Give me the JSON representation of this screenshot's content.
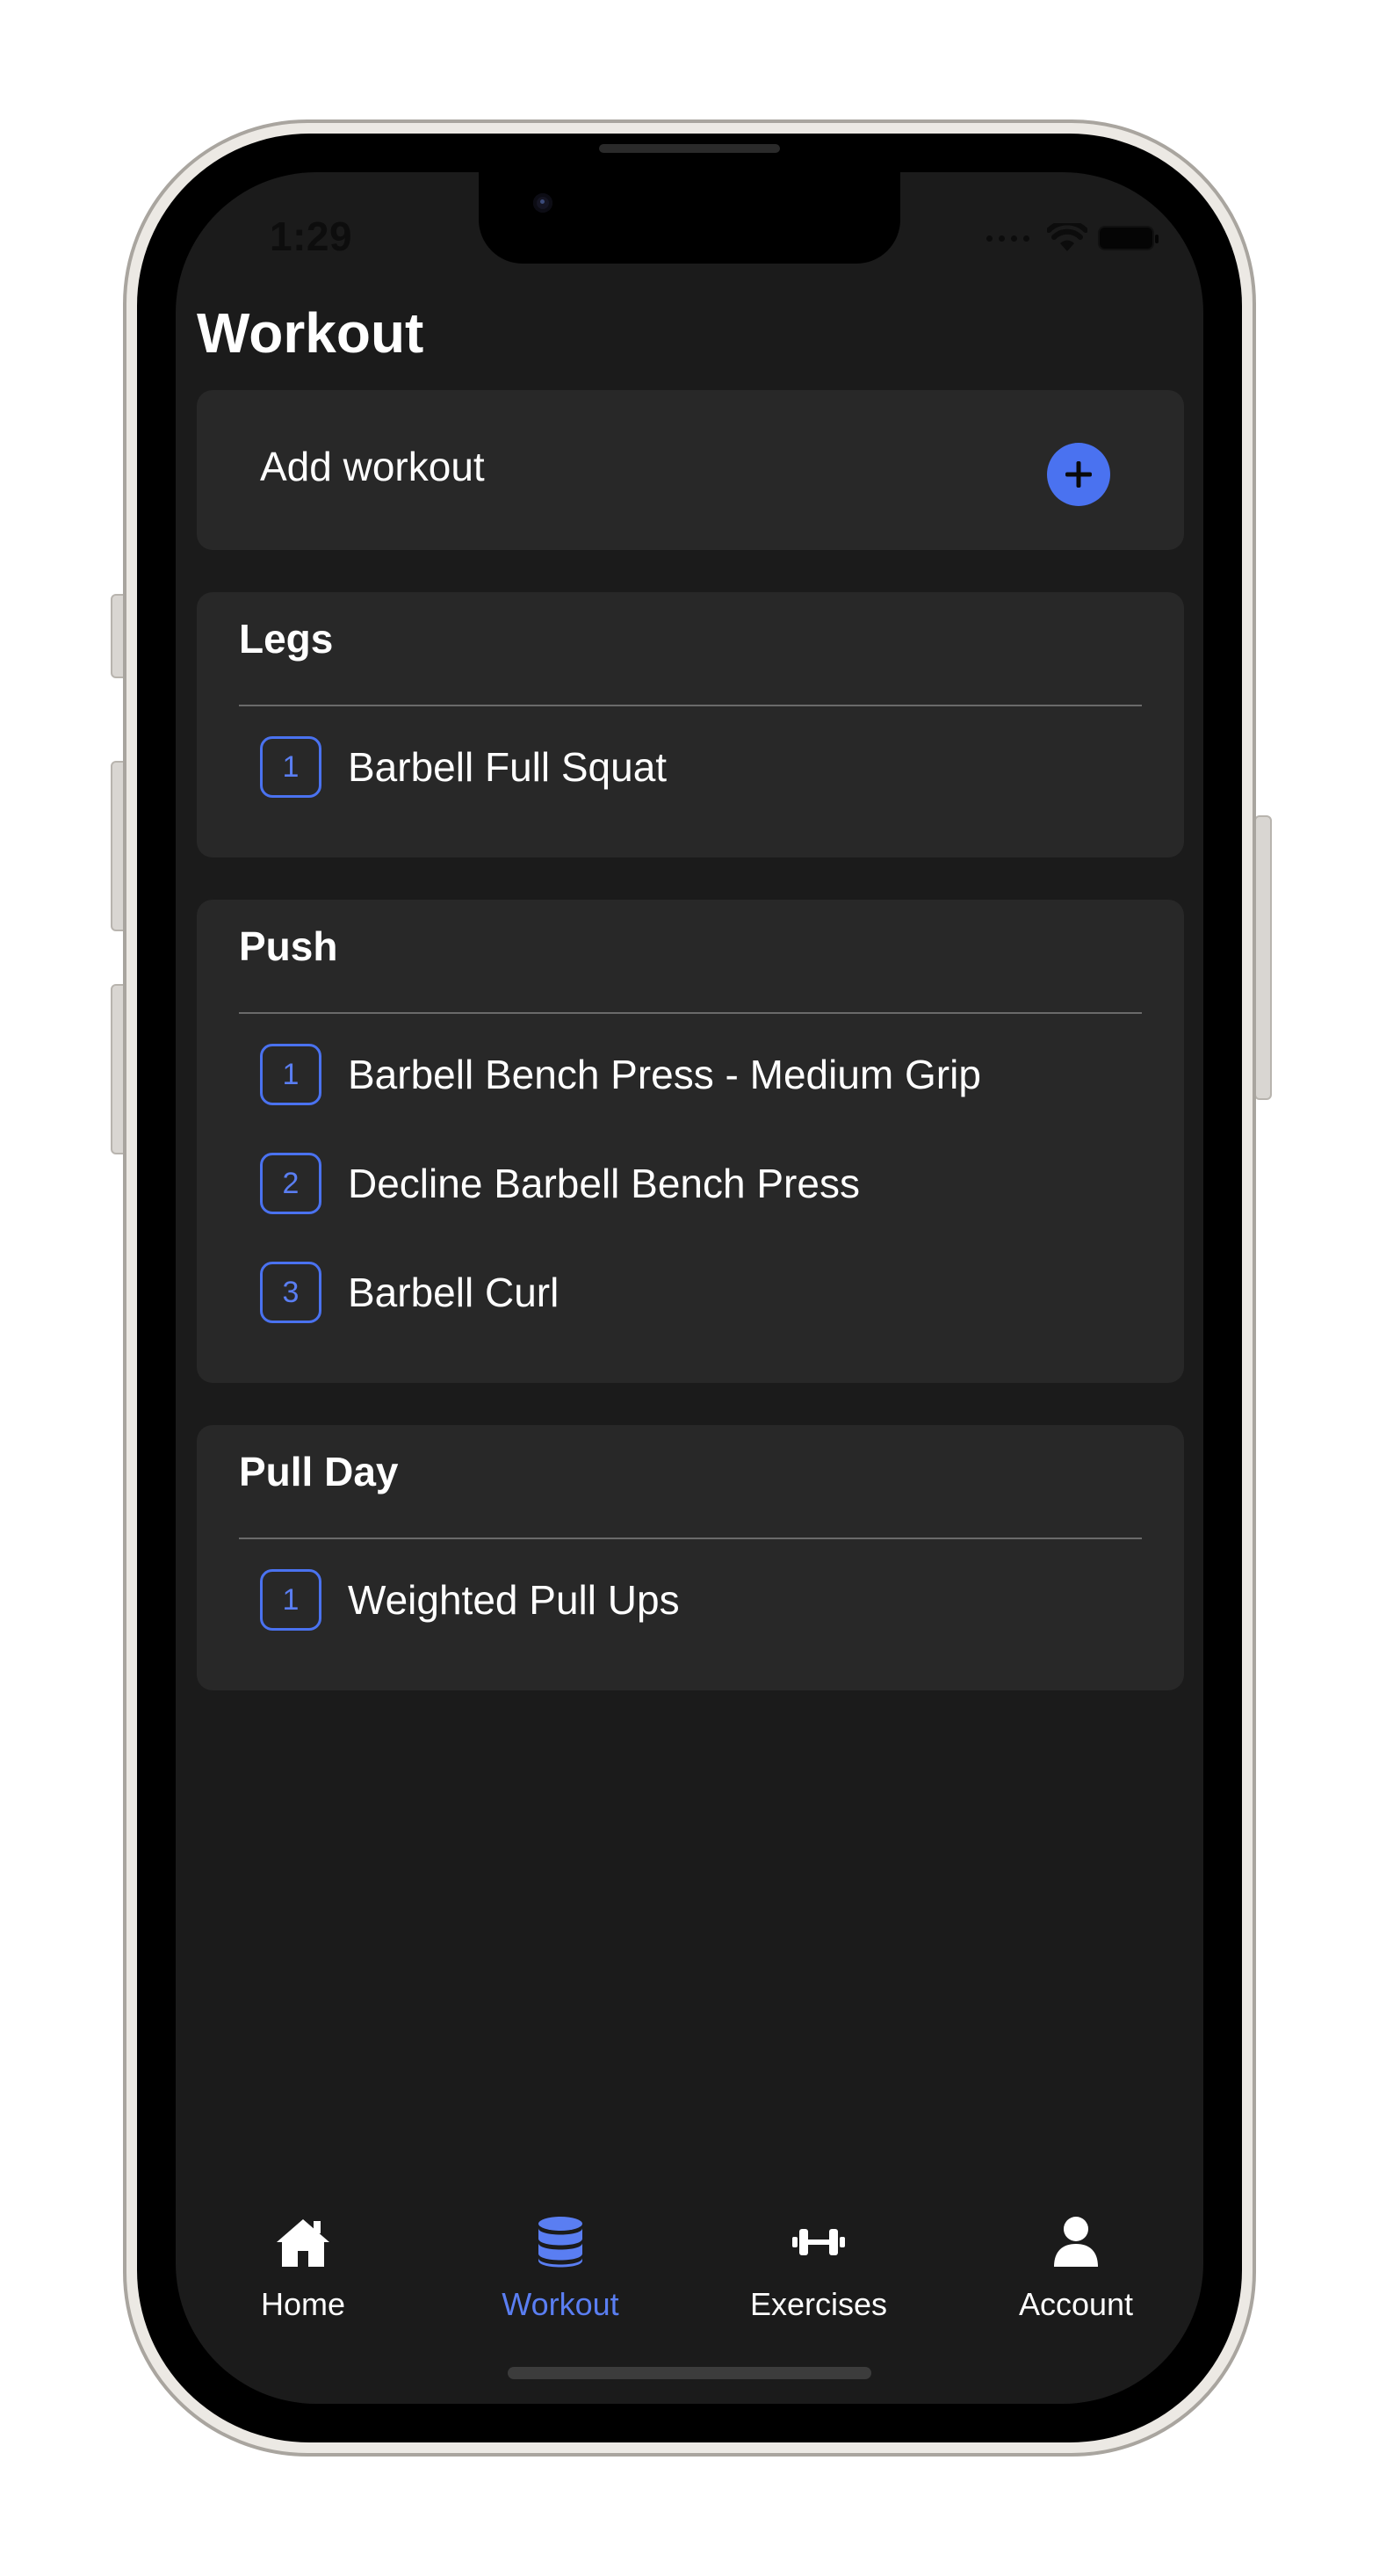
{
  "status_bar": {
    "time": "1:29"
  },
  "page_title": "Workout",
  "add_workout": {
    "label": "Add workout",
    "button_icon": "plus-icon"
  },
  "workouts": [
    {
      "name": "Legs",
      "exercises": [
        {
          "index": "1",
          "name": "Barbell Full Squat"
        }
      ]
    },
    {
      "name": "Push",
      "exercises": [
        {
          "index": "1",
          "name": "Barbell Bench Press - Medium Grip"
        },
        {
          "index": "2",
          "name": "Decline Barbell Bench Press"
        },
        {
          "index": "3",
          "name": "Barbell Curl"
        }
      ]
    },
    {
      "name": "Pull Day",
      "exercises": [
        {
          "index": "1",
          "name": "Weighted Pull Ups"
        }
      ]
    }
  ],
  "tab_bar": {
    "active": "Workout",
    "tabs": [
      {
        "label": "Home",
        "icon": "home-icon"
      },
      {
        "label": "Workout",
        "icon": "database-icon"
      },
      {
        "label": "Exercises",
        "icon": "dumbbell-icon"
      },
      {
        "label": "Account",
        "icon": "user-icon"
      }
    ]
  },
  "colors": {
    "accent": "#4a72f0",
    "background": "#1b1b1b",
    "card": "#282828",
    "text": "#ffffff"
  }
}
